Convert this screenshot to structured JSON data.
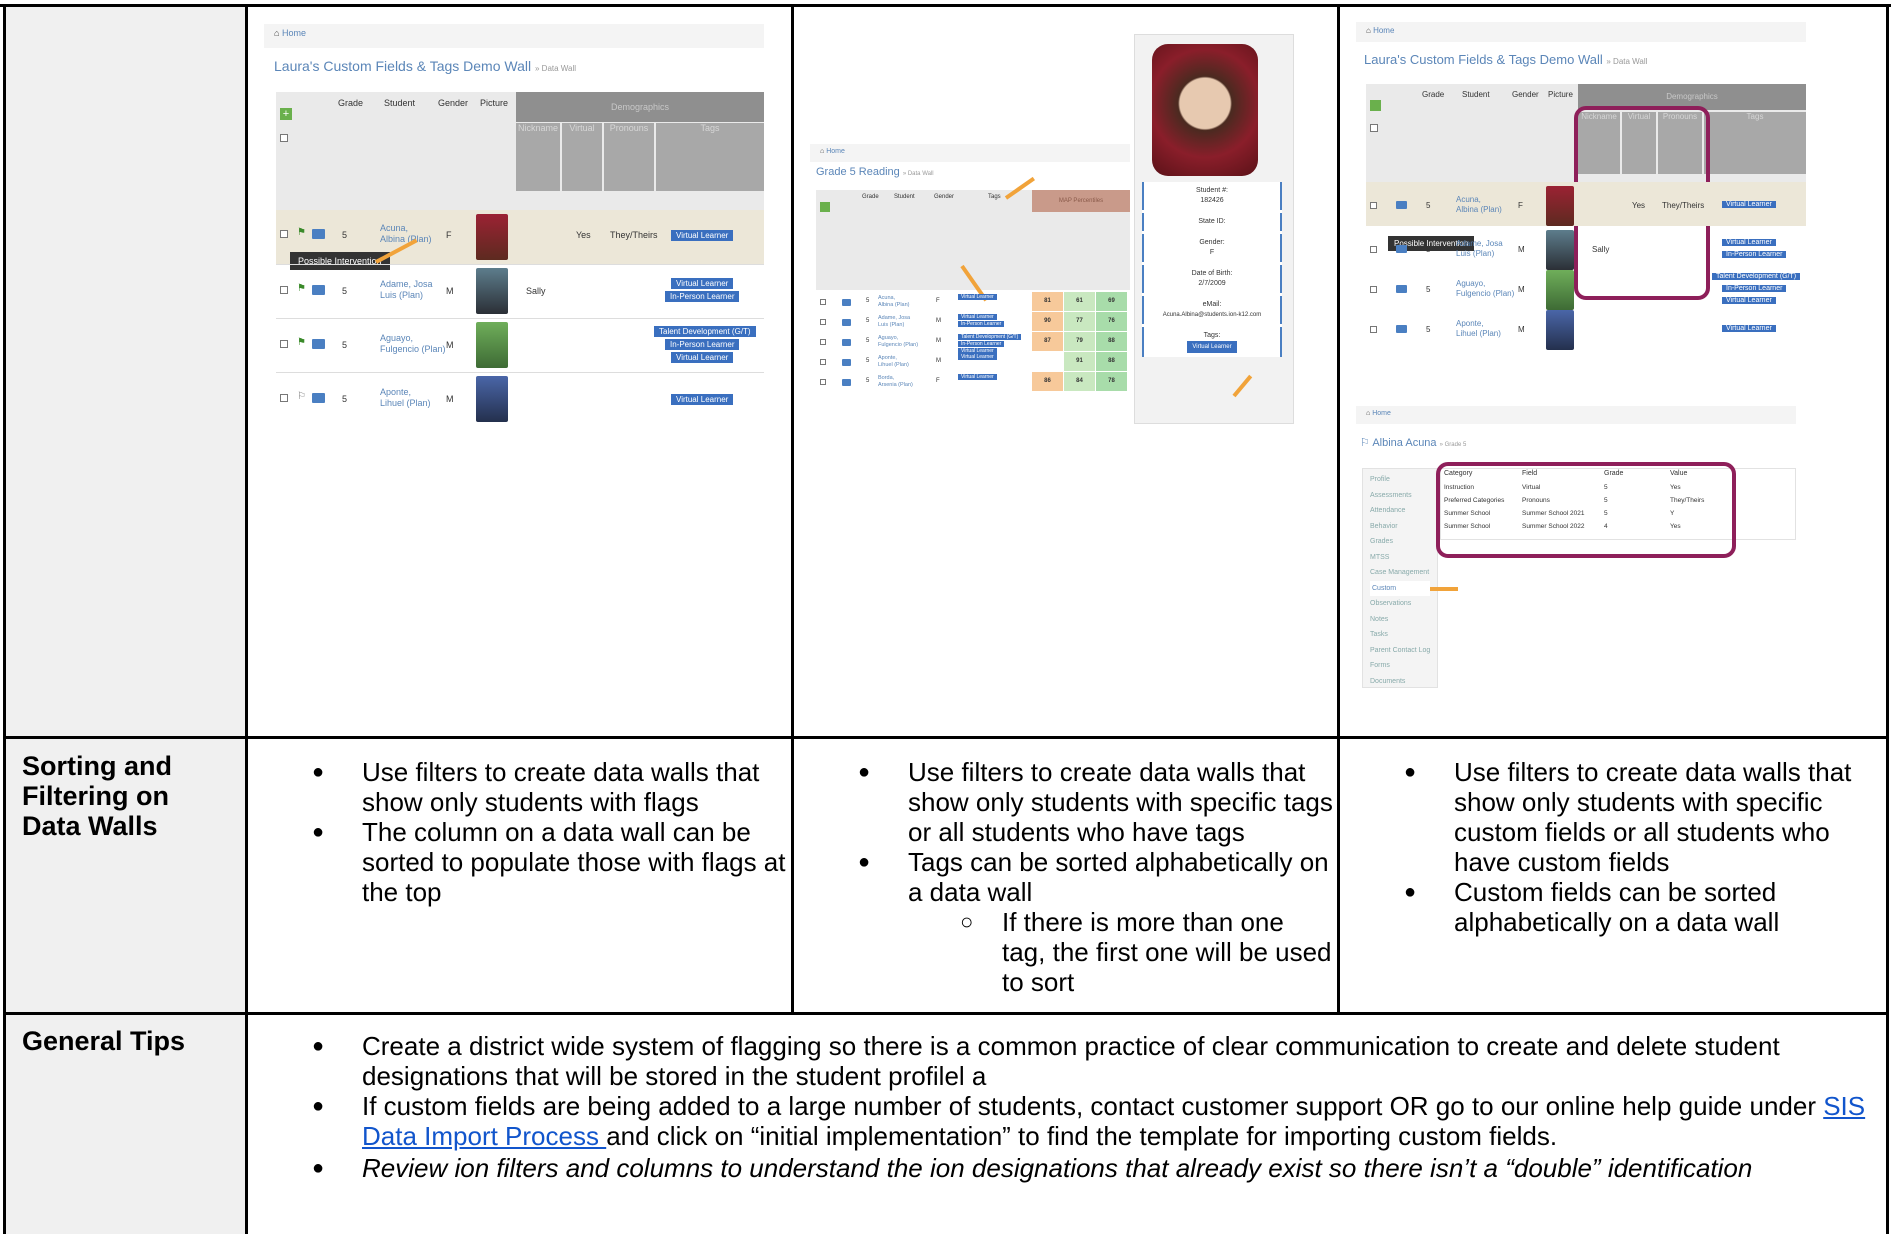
{
  "panel1": {
    "breadcrumb": "Home",
    "title": "Laura's Custom Fields & Tags Demo Wall",
    "subtitle": "» Data Wall",
    "columns": [
      "Grade",
      "Student",
      "Gender",
      "Picture"
    ],
    "group_header": "Demographics",
    "sub_columns": [
      "Nickname",
      "Virtual",
      "Pronouns",
      "Tags"
    ],
    "tooltip": "Possible Intervention",
    "rows": [
      {
        "grade": "5",
        "name1": "Acuna,",
        "name2": "Albina (Plan)",
        "gender": "F",
        "nickname": "",
        "virtual": "Yes",
        "pronouns": "They/Theirs",
        "tags": [
          "Virtual Learner"
        ]
      },
      {
        "grade": "5",
        "name1": "Adame, Josa",
        "name2": "Luis (Plan)",
        "gender": "M",
        "nickname": "Sally",
        "virtual": "",
        "pronouns": "",
        "tags": [
          "Virtual Learner",
          "In-Person Learner"
        ]
      },
      {
        "grade": "5",
        "name1": "Aguayo,",
        "name2": "Fulgencio (Plan)",
        "gender": "M",
        "nickname": "",
        "virtual": "",
        "pronouns": "",
        "tags": [
          "Talent Development (G/T)",
          "In-Person Learner",
          "Virtual Learner"
        ]
      },
      {
        "grade": "5",
        "name1": "Aponte,",
        "name2": "Lihuel (Plan)",
        "gender": "M",
        "nickname": "",
        "virtual": "",
        "pronouns": "",
        "tags": [
          "Virtual Learner"
        ]
      }
    ]
  },
  "panel2": {
    "breadcrumb": "Home",
    "title": "Grade 5 Reading",
    "subtitle": "» Data Wall",
    "columns": [
      "Grade",
      "Student",
      "Gender",
      "Tags"
    ],
    "group_header": "MAP Percentiles",
    "rows": [
      {
        "grade": "5",
        "name1": "Acuna,",
        "name2": "Albina (Plan)",
        "gender": "F",
        "tags": [
          "Virtual Learner"
        ],
        "scores": [
          "81",
          "61",
          "69"
        ]
      },
      {
        "grade": "5",
        "name1": "Adame, Josa",
        "name2": "Luis (Plan)",
        "gender": "M",
        "tags": [
          "Virtual Learner",
          "In-Person Learner"
        ],
        "scores": [
          "90",
          "77",
          "76"
        ]
      },
      {
        "grade": "5",
        "name1": "Aguayo,",
        "name2": "Fulgencio (Plan)",
        "gender": "M",
        "tags": [
          "Talent Development (G/T)",
          "In-Person Learner",
          "Virtual Learner"
        ],
        "scores": [
          "87",
          "79",
          "88"
        ]
      },
      {
        "grade": "5",
        "name1": "Aponte,",
        "name2": "Lihuel (Plan)",
        "gender": "M",
        "tags": [
          "Virtual Learner"
        ],
        "scores": [
          "",
          "91",
          "88"
        ]
      },
      {
        "grade": "5",
        "name1": "Borda,",
        "name2": "Arsenia (Plan)",
        "gender": "F",
        "tags": [
          "Virtual Learner"
        ],
        "scores": [
          "86",
          "84",
          "78"
        ]
      }
    ],
    "profile": {
      "student_no_label": "Student #:",
      "student_no": "182426",
      "state_id_label": "State ID:",
      "gender_label": "Gender:",
      "gender": "F",
      "dob_label": "Date of Birth:",
      "dob": "2/7/2009",
      "email_label": "eMail:",
      "email": "Acuna.Albina@students.ion-k12.com",
      "tags_label": "Tags:",
      "tag": "Virtual Learner"
    }
  },
  "panel3": {
    "breadcrumb": "Home",
    "title": "Laura's Custom Fields & Tags Demo Wall",
    "subtitle": "» Data Wall",
    "tooltip": "Possible Intervention",
    "columns": [
      "Grade",
      "Student",
      "Gender",
      "Picture"
    ],
    "group_header": "Demographics",
    "sub_columns": [
      "Nickname",
      "Virtual",
      "Pronouns",
      "Tags"
    ],
    "rows": [
      {
        "grade": "5",
        "name1": "Acuna,",
        "name2": "Albina (Plan)",
        "gender": "F",
        "nickname": "",
        "virtual": "Yes",
        "pronouns": "They/Theirs",
        "tags": [
          "Virtual Learner"
        ]
      },
      {
        "grade": "5",
        "name1": "Adame, Josa",
        "name2": "Luis (Plan)",
        "gender": "M",
        "nickname": "Sally",
        "virtual": "",
        "pronouns": "",
        "tags": [
          "Virtual Learner",
          "In-Person Learner"
        ]
      },
      {
        "grade": "5",
        "name1": "Aguayo,",
        "name2": "Fulgencio (Plan)",
        "gender": "M",
        "nickname": "",
        "virtual": "",
        "pronouns": "",
        "tags": [
          "Talent Development (G/T)",
          "In-Person Learner",
          "Virtual Learner"
        ]
      },
      {
        "grade": "5",
        "name1": "Aponte,",
        "name2": "Lihuel (Plan)",
        "gender": "M",
        "nickname": "",
        "virtual": "",
        "pronouns": "",
        "tags": [
          "Virtual Learner"
        ]
      }
    ],
    "profile_breadcrumb": "Home",
    "profile_name": "Albina Acuna",
    "profile_grade": "» Grade 5",
    "side_menu": [
      "Profile",
      "Assessments",
      "Attendance",
      "Behavior",
      "Grades",
      "MTSS",
      "Case Management",
      "Custom",
      "Observations",
      "Notes",
      "Tasks",
      "Parent Contact Log",
      "Forms",
      "Documents"
    ],
    "custom_columns": [
      "Category",
      "Field",
      "Grade",
      "Value"
    ],
    "custom_rows": [
      [
        "Instruction",
        "Virtual",
        "5",
        "Yes"
      ],
      [
        "Preferred Categories",
        "Pronouns",
        "5",
        "They/Theirs"
      ],
      [
        "Summer School",
        "Summer School 2021",
        "5",
        "Y"
      ],
      [
        "Summer School",
        "Summer School 2022",
        "4",
        "Yes"
      ]
    ]
  },
  "sorting": {
    "header": "Sorting and Filtering on Data Walls",
    "col1": [
      "Use filters to create data walls that show only students with flags",
      "The column on a data wall can be sorted to populate those with flags at the top"
    ],
    "col2": [
      "Use filters to create data walls that show only students with specific tags or all students who have tags",
      "Tags can be sorted alphabetically on a data wall"
    ],
    "col2_sub": "If there is more than one tag, the first one will be used to sort",
    "col3": [
      "Use filters to create data walls that show only students with specific custom fields or all students who have custom fields",
      "Custom fields can be sorted alphabetically on a data wall"
    ]
  },
  "tips": {
    "header": "General Tips",
    "tip1": "Create a district wide system of flagging so there is a common practice of clear communication to create and delete student designations that will be stored in the student profilel a",
    "tip2_pre": "If custom fields are being added to a large number of students, contact customer support  OR go to our online help guide under ",
    "tip2_link": "SIS Data Import Process ",
    "tip2_post": " and click on “initial implementation” to find the template for importing custom fields.",
    "tip3": "Review ion filters and columns to understand the ion designations that already exist so there isn’t a “double” identification"
  }
}
